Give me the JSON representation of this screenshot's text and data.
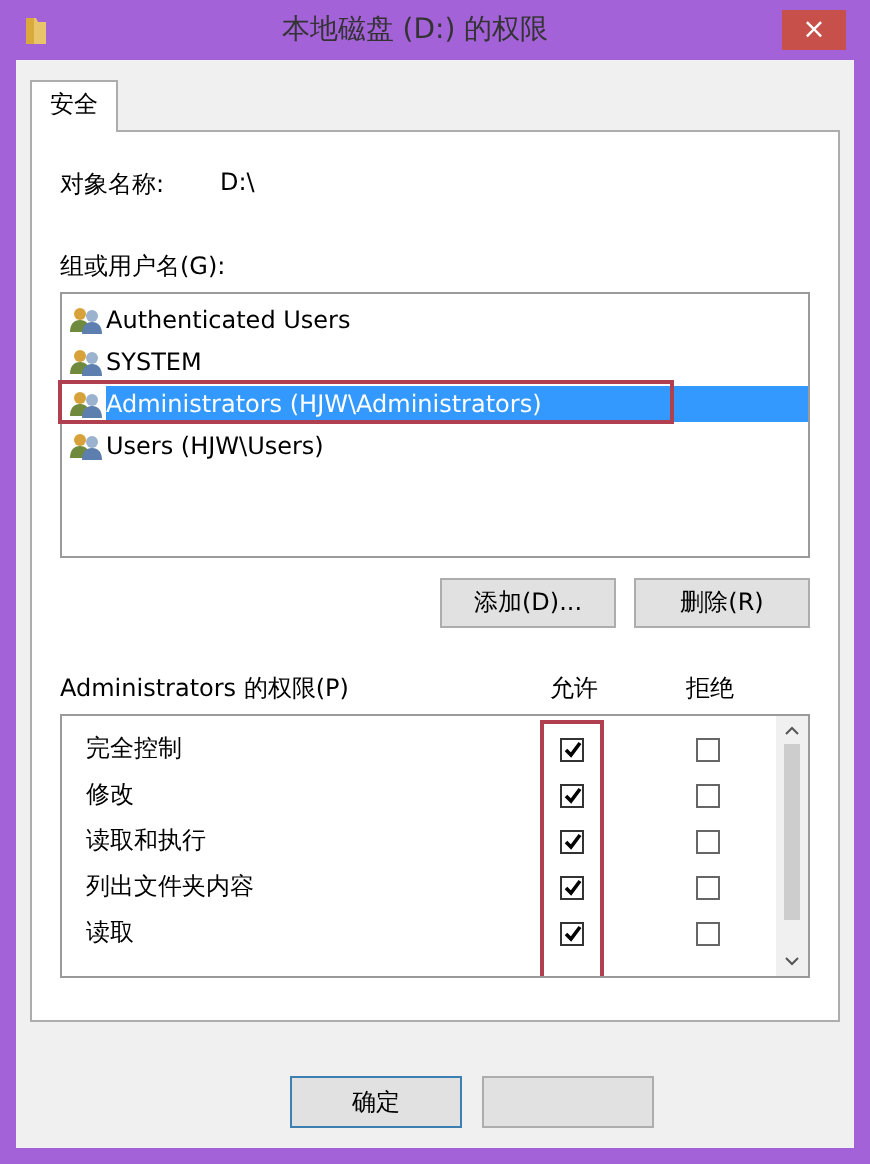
{
  "window": {
    "title": "本地磁盘 (D:) 的权限",
    "close": "×"
  },
  "tabs": [
    {
      "label": "安全",
      "selected": true
    }
  ],
  "object_name": {
    "label": "对象名称:",
    "value": "D:\\"
  },
  "users": {
    "label": "组或用户名(G):",
    "items": [
      {
        "name": "Authenticated Users",
        "selected": false,
        "highlighted": false
      },
      {
        "name": "SYSTEM",
        "selected": false,
        "highlighted": false
      },
      {
        "name": "Administrators (HJW\\Administrators)",
        "selected": true,
        "highlighted": true
      },
      {
        "name": "Users (HJW\\Users)",
        "selected": false,
        "highlighted": false
      }
    ]
  },
  "user_buttons": [
    "添加(D)...",
    "删除(R)"
  ],
  "permissions": {
    "label": "Administrators 的权限(P)",
    "allow_header": "允许",
    "deny_header": "拒绝",
    "allow_highlighted": true,
    "rows": [
      {
        "name": "完全控制",
        "allow": true,
        "deny": false
      },
      {
        "name": "修改",
        "allow": true,
        "deny": false
      },
      {
        "name": "读取和执行",
        "allow": true,
        "deny": false
      },
      {
        "name": "列出文件夹内容",
        "allow": true,
        "deny": false
      },
      {
        "name": "读取",
        "allow": true,
        "deny": false
      }
    ]
  },
  "buttons": [
    "确定"
  ]
}
